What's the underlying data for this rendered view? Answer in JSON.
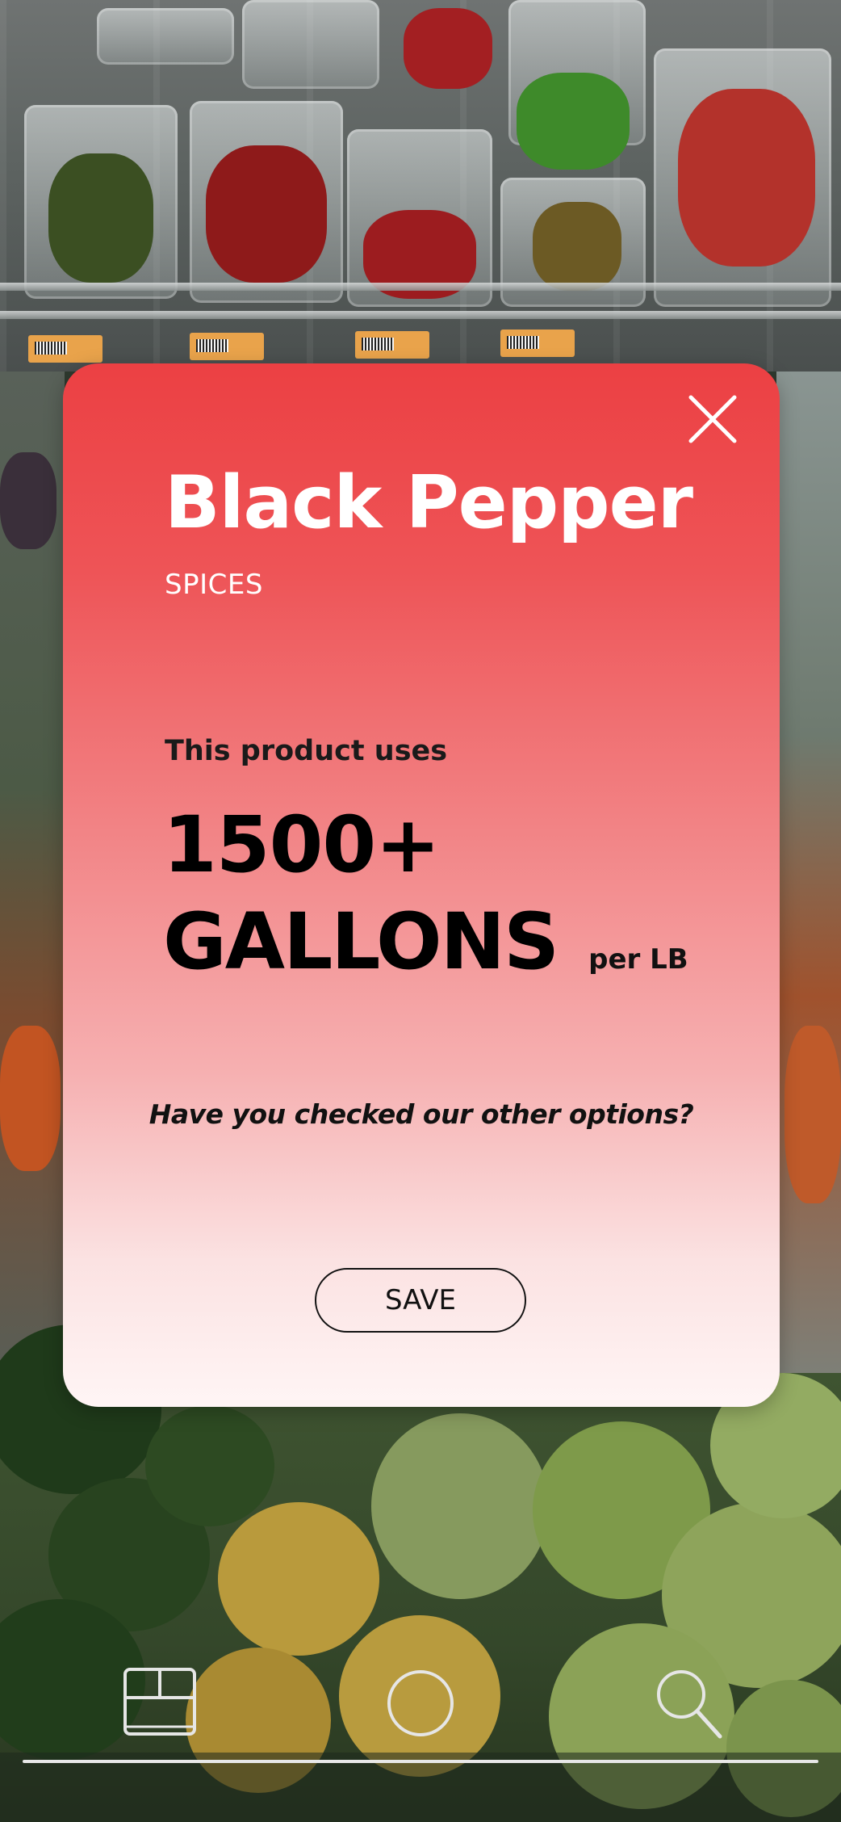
{
  "product": {
    "name": "Black Pepper",
    "category": "SPICES"
  },
  "usage": {
    "label": "This product uses",
    "amount": "1500+",
    "unit": "GALLONS",
    "per_unit": "per LB"
  },
  "prompt": {
    "question": "Have you checked our other options?"
  },
  "actions": {
    "save_label": "SAVE"
  },
  "icons": {
    "close": "close-icon",
    "nav_left": "layout-icon",
    "nav_center": "circle-icon",
    "nav_right": "search-icon"
  },
  "colors": {
    "card_top": "#ec4043",
    "card_bottom": "#fff5f5",
    "title_text": "#ffffff",
    "body_text": "#000000"
  }
}
